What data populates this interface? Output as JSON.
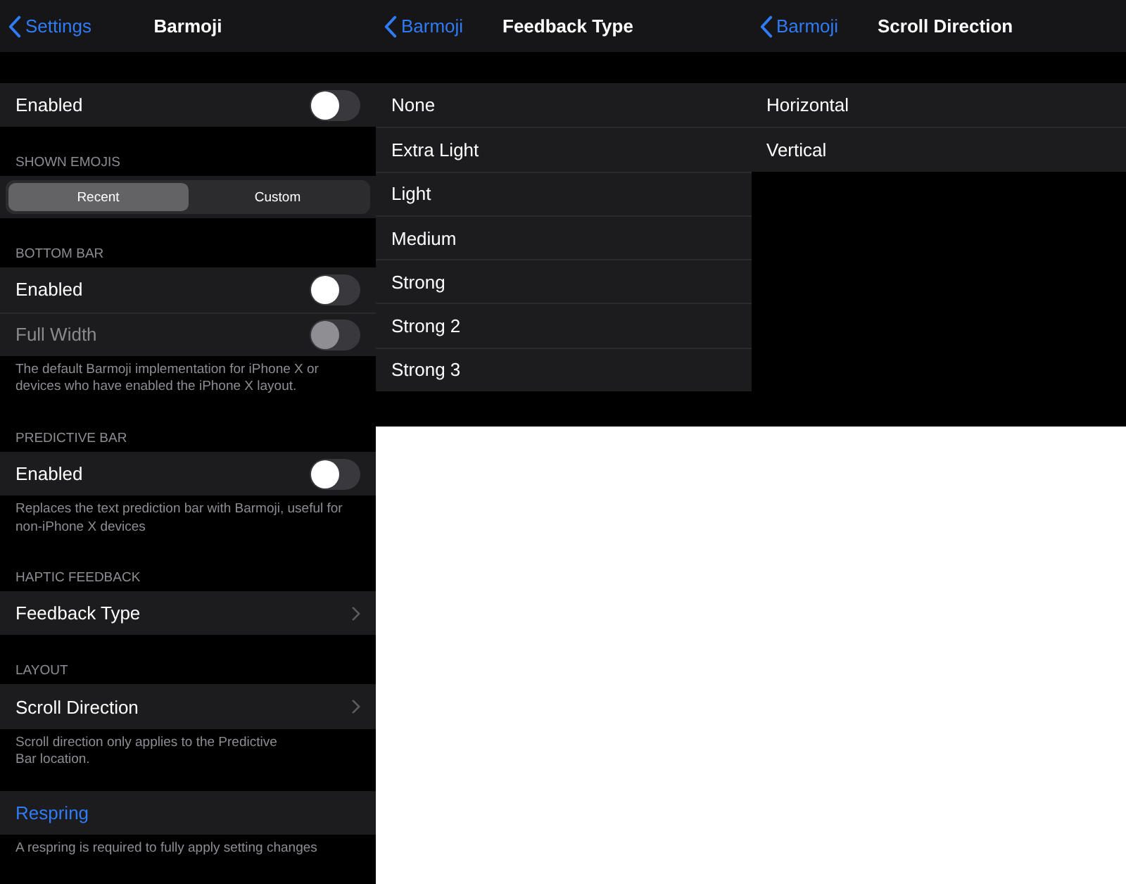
{
  "panels": [
    {
      "back": "Settings",
      "title": "Barmoji",
      "sections": [
        {
          "rows": [
            {
              "kind": "toggle",
              "label": "Enabled",
              "on": false,
              "disabled": false
            }
          ]
        },
        {
          "header": "SHOWN EMOJIS",
          "rows": [
            {
              "kind": "segmented",
              "segments": [
                {
                  "label": "Recent",
                  "selected": true
                },
                {
                  "label": "Custom",
                  "selected": false
                }
              ]
            }
          ]
        },
        {
          "header": "BOTTOM BAR",
          "rows": [
            {
              "kind": "toggle",
              "label": "Enabled",
              "on": false,
              "disabled": false
            },
            {
              "kind": "toggle",
              "label": "Full Width",
              "on": false,
              "disabled": true
            }
          ],
          "footer": "The default Barmoji implementation for iPhone X or devices who have enabled the iPhone X layout."
        },
        {
          "header": "PREDICTIVE BAR",
          "rows": [
            {
              "kind": "toggle",
              "label": "Enabled",
              "on": false,
              "disabled": false
            }
          ],
          "footer": "Replaces the text prediction bar with Barmoji, useful for non-iPhone X devices"
        },
        {
          "header": "HAPTIC FEEDBACK",
          "rows": [
            {
              "kind": "link",
              "label": "Feedback Type"
            }
          ]
        },
        {
          "header": "LAYOUT",
          "rows": [
            {
              "kind": "link",
              "label": "Scroll Direction"
            }
          ],
          "footer": "Scroll direction only applies to the Predictive\nBar location."
        },
        {
          "rows": [
            {
              "kind": "action",
              "label": "Respring"
            }
          ],
          "footer": "A respring is required to fully apply setting changes"
        }
      ]
    },
    {
      "back": "Barmoji",
      "title": "Feedback Type",
      "sections": [
        {
          "rows": [
            {
              "kind": "option",
              "label": "None"
            },
            {
              "kind": "option",
              "label": "Extra Light"
            },
            {
              "kind": "option",
              "label": "Light"
            },
            {
              "kind": "option",
              "label": "Medium"
            },
            {
              "kind": "option",
              "label": "Strong"
            },
            {
              "kind": "option",
              "label": "Strong 2"
            },
            {
              "kind": "option",
              "label": "Strong 3"
            }
          ]
        }
      ]
    },
    {
      "back": "Barmoji",
      "title": "Scroll Direction",
      "sections": [
        {
          "rows": [
            {
              "kind": "option",
              "label": "Horizontal"
            },
            {
              "kind": "option",
              "label": "Vertical"
            }
          ]
        }
      ]
    }
  ]
}
